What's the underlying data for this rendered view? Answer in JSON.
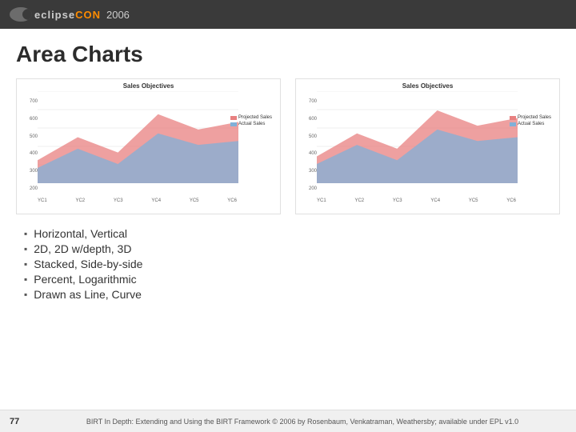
{
  "header": {
    "logo_text": "eclipse",
    "logo_highlight": "CON",
    "year": "2006"
  },
  "page": {
    "title": "Area Charts"
  },
  "charts": [
    {
      "id": "chart1",
      "title": "Sales Objectives",
      "y_labels": [
        "700",
        "600",
        "500",
        "400",
        "300",
        "200"
      ],
      "x_labels": [
        "YC1",
        "YC2",
        "YC3",
        "YC4",
        "YC5",
        "YC6"
      ],
      "legend": [
        {
          "label": "Projected Sales",
          "color": "#e88080"
        },
        {
          "label": "Actual Sales",
          "color": "#80b0d8"
        }
      ]
    },
    {
      "id": "chart2",
      "title": "Sales Objectives",
      "y_labels": [
        "700",
        "600",
        "500",
        "400",
        "300",
        "200"
      ],
      "x_labels": [
        "YC1",
        "YC2",
        "YC3",
        "YC4",
        "YC5",
        "YC6"
      ],
      "legend": [
        {
          "label": "Projected Sales",
          "color": "#e88080"
        },
        {
          "label": "Actual Sales",
          "color": "#80b0d8"
        }
      ]
    }
  ],
  "bullets": [
    "Horizontal, Vertical",
    "2D, 2D w/depth, 3D",
    "Stacked, Side-by-side",
    "Percent, Logarithmic",
    "Drawn as Line, Curve"
  ],
  "footer": {
    "page_number": "77",
    "text": "BIRT In Depth: Extending and Using the BIRT Framework © 2006 by Rosenbaum, Venkatraman, Weathersby; available under EPL v1.0"
  }
}
